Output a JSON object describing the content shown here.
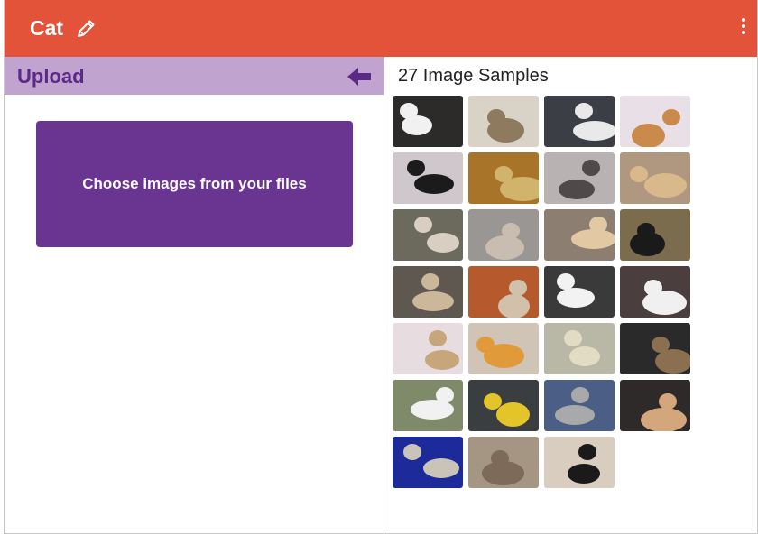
{
  "header": {
    "title": "Cat",
    "edit_icon": "pencil-icon",
    "menu_icon": "kebab-menu-icon",
    "color": "#e2533a"
  },
  "upload": {
    "label": "Upload",
    "back_icon": "arrow-left-icon",
    "bar_color": "#c1a3cf",
    "choose_button": "Choose images from your files",
    "button_color": "#6a3591"
  },
  "samples": {
    "title": "27 Image Samples",
    "count": 27,
    "thumbnails": [
      {
        "bg": "#2d2a2a",
        "cat": "#f1f1f1"
      },
      {
        "bg": "#d9d2c6",
        "cat": "#8d7a5f"
      },
      {
        "bg": "#3b3e44",
        "cat": "#e9e9e9"
      },
      {
        "bg": "#e9dfe7",
        "cat": "#c98a4c"
      },
      {
        "bg": "#cfc7cc",
        "cat": "#1b1b1b"
      },
      {
        "bg": "#a8742a",
        "cat": "#d2b36b"
      },
      {
        "bg": "#b8b2b3",
        "cat": "#4d4a49"
      },
      {
        "bg": "#b09880",
        "cat": "#d9b98b"
      },
      {
        "bg": "#6b6a5d",
        "cat": "#d8cfc2"
      },
      {
        "bg": "#9a9694",
        "cat": "#c8bdb0"
      },
      {
        "bg": "#8c7f72",
        "cat": "#e2c9a4"
      },
      {
        "bg": "#7a6c4c",
        "cat": "#1a1a1a"
      },
      {
        "bg": "#5f5850",
        "cat": "#cbb89a"
      },
      {
        "bg": "#b65a2e",
        "cat": "#d1c1aa"
      },
      {
        "bg": "#3a3a3a",
        "cat": "#f2f2f2"
      },
      {
        "bg": "#4a3e3e",
        "cat": "#f0f0f0"
      },
      {
        "bg": "#e7dde0",
        "cat": "#c7a67b"
      },
      {
        "bg": "#cfc4b5",
        "cat": "#e09a3a"
      },
      {
        "bg": "#b9b7a5",
        "cat": "#e3dcc4"
      },
      {
        "bg": "#2a2a2a",
        "cat": "#8a6f50"
      },
      {
        "bg": "#7f8a6a",
        "cat": "#f1f1f1"
      },
      {
        "bg": "#3a3e40",
        "cat": "#e3c52a"
      },
      {
        "bg": "#4a5e86",
        "cat": "#a9a9a9"
      },
      {
        "bg": "#2f2a2a",
        "cat": "#d3a67c"
      },
      {
        "bg": "#1c2a9a",
        "cat": "#c9c3b8"
      },
      {
        "bg": "#a49682",
        "cat": "#7d6a58"
      },
      {
        "bg": "#d8cdbf",
        "cat": "#1a1a1a"
      }
    ]
  }
}
